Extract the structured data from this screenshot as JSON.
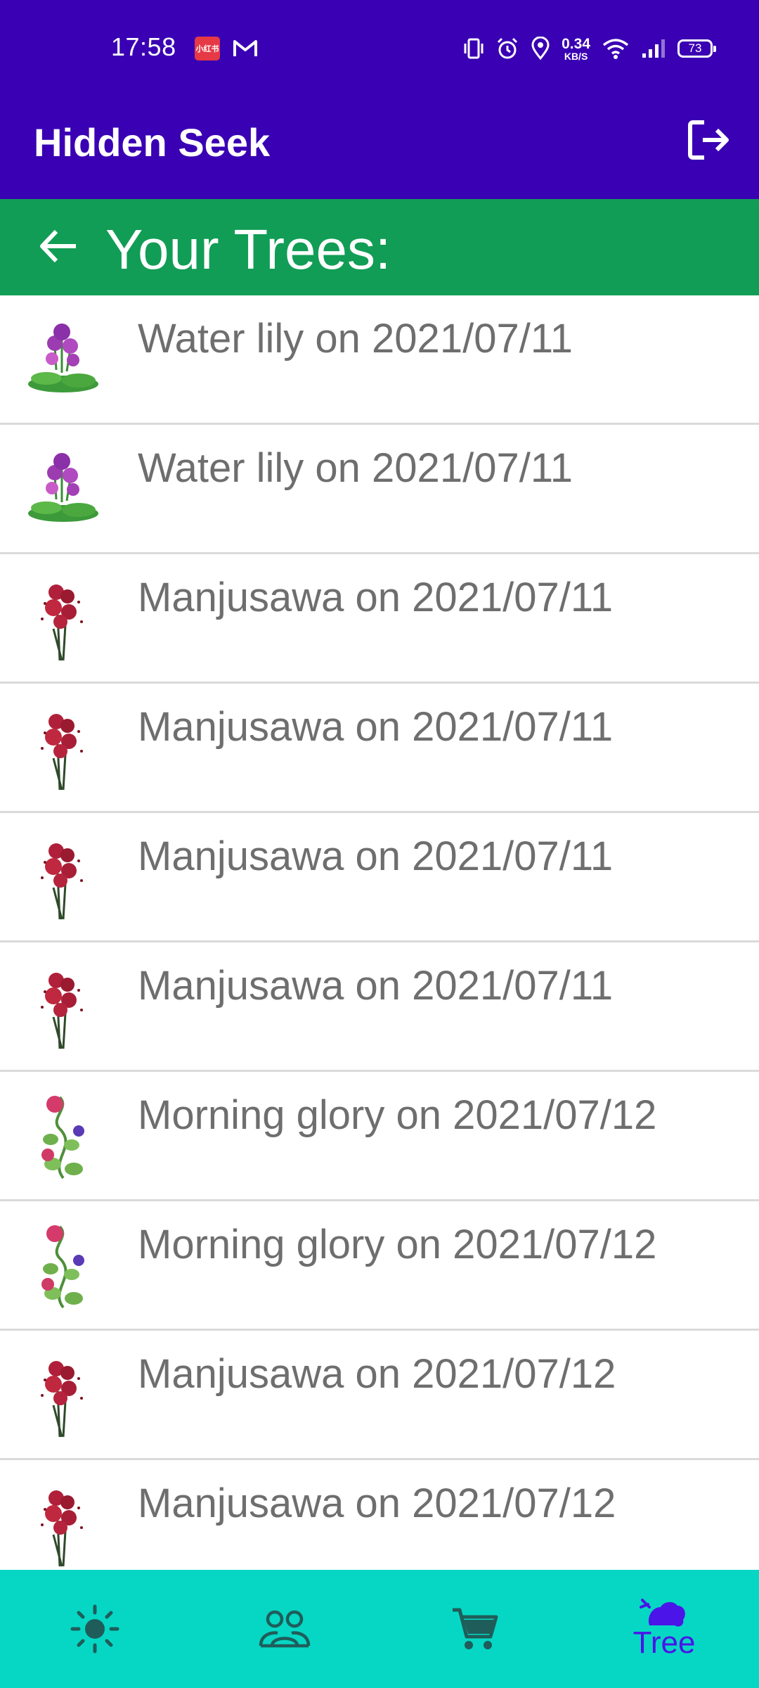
{
  "status_bar": {
    "time": "17:58",
    "notification_app_badge": "小红书",
    "network_speed_value": "0.34",
    "network_speed_unit": "KB/S",
    "battery_level": "73"
  },
  "app_bar": {
    "title": "Hidden Seek",
    "logout_icon": "logout-icon"
  },
  "section": {
    "back_icon": "arrow-left-icon",
    "heading": "Your Trees:"
  },
  "trees": [
    {
      "label": "Water lily on 2021/07/11",
      "icon": "water-lily-icon"
    },
    {
      "label": "Water lily on 2021/07/11",
      "icon": "water-lily-icon"
    },
    {
      "label": "Manjusawa on 2021/07/11",
      "icon": "manjusawa-icon"
    },
    {
      "label": "Manjusawa on 2021/07/11",
      "icon": "manjusawa-icon"
    },
    {
      "label": "Manjusawa on 2021/07/11",
      "icon": "manjusawa-icon"
    },
    {
      "label": "Manjusawa on 2021/07/11",
      "icon": "manjusawa-icon"
    },
    {
      "label": "Morning glory on 2021/07/12",
      "icon": "morning-glory-icon"
    },
    {
      "label": "Morning glory on 2021/07/12",
      "icon": "morning-glory-icon"
    },
    {
      "label": "Manjusawa on 2021/07/12",
      "icon": "manjusawa-icon"
    },
    {
      "label": "Manjusawa on 2021/07/12",
      "icon": "manjusawa-icon"
    }
  ],
  "bottom_nav": {
    "items": [
      {
        "icon": "sun-icon",
        "label": ""
      },
      {
        "icon": "people-icon",
        "label": ""
      },
      {
        "icon": "cart-icon",
        "label": ""
      },
      {
        "icon": "tree-icon",
        "label": "Tree",
        "selected": true
      }
    ]
  },
  "colors": {
    "app_bar": "#3A00B3",
    "section_bar": "#119D55",
    "bottom_nav": "#06D7C4",
    "nav_selected": "#4B14E8",
    "nav_unselected": "#1F5D5A",
    "row_text": "#6E6E6E",
    "divider": "#DADADA"
  }
}
